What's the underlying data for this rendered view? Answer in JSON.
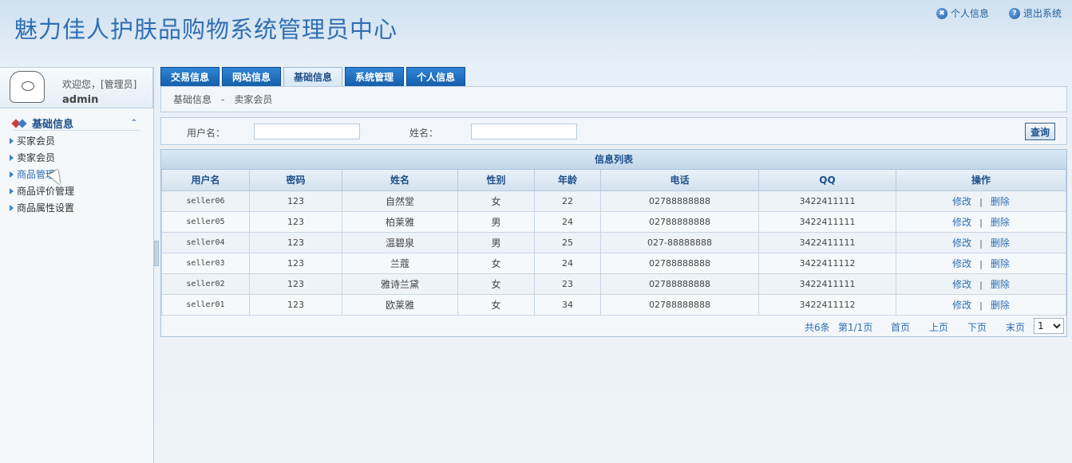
{
  "header": {
    "title": "魅力佳人护肤品购物系统管理员中心",
    "links": [
      {
        "label": "个人信息",
        "icon": "info-icon"
      },
      {
        "label": "退出系统",
        "icon": "help-icon"
      }
    ]
  },
  "sidebar": {
    "welcome": "欢迎您，[管理员]",
    "username": "admin",
    "section": "基础信息",
    "items": [
      {
        "label": "买家会员"
      },
      {
        "label": "卖家会员"
      },
      {
        "label": "商品管理"
      },
      {
        "label": "商品评价管理"
      },
      {
        "label": "商品属性设置"
      }
    ]
  },
  "tabs": [
    {
      "label": "交易信息"
    },
    {
      "label": "网站信息"
    },
    {
      "label": "基础信息"
    },
    {
      "label": "系统管理"
    },
    {
      "label": "个人信息"
    }
  ],
  "breadcrumb": {
    "section": "基础信息",
    "separator": "-",
    "page": "卖家会员"
  },
  "search": {
    "username_label": "用户名：",
    "username_value": "",
    "name_label": "姓名：",
    "name_value": "",
    "query_label": "查询"
  },
  "list": {
    "title": "信息列表",
    "columns": [
      "用户名",
      "密码",
      "姓名",
      "性别",
      "年龄",
      "电话",
      "QQ",
      "操作"
    ],
    "rows": [
      {
        "username": "seller06",
        "password": "123",
        "name": "自然堂",
        "gender": "女",
        "age": "22",
        "phone": "02788888888",
        "qq": "3422411111"
      },
      {
        "username": "seller05",
        "password": "123",
        "name": "柏莱雅",
        "gender": "男",
        "age": "24",
        "phone": "02788888888",
        "qq": "3422411111"
      },
      {
        "username": "seller04",
        "password": "123",
        "name": "温碧泉",
        "gender": "男",
        "age": "25",
        "phone": "027-88888888",
        "qq": "3422411111"
      },
      {
        "username": "seller03",
        "password": "123",
        "name": "兰蔻",
        "gender": "女",
        "age": "24",
        "phone": "02788888888",
        "qq": "3422411112"
      },
      {
        "username": "seller02",
        "password": "123",
        "name": "雅诗兰黛",
        "gender": "女",
        "age": "23",
        "phone": "02788888888",
        "qq": "3422411111"
      },
      {
        "username": "seller01",
        "password": "123",
        "name": "欧莱雅",
        "gender": "女",
        "age": "34",
        "phone": "02788888888",
        "qq": "3422411112"
      }
    ],
    "edit_label": "修改",
    "op_separator": "|",
    "delete_label": "删除"
  },
  "pager": {
    "total": "共6条",
    "page_info": "第1/1页",
    "first": "首页",
    "prev": "上页",
    "next": "下页",
    "last": "末页",
    "selected_page": "1"
  }
}
